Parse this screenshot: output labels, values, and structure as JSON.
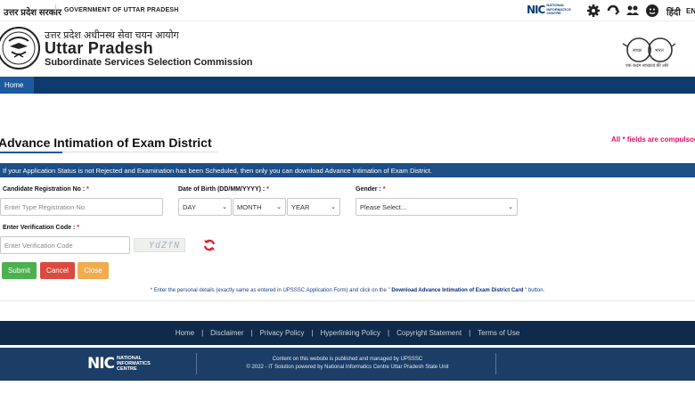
{
  "topbar": {
    "gov_hindi": "उत्तर प्रदेश सरकार",
    "gov_english": "GOVERNMENT OF UTTAR PRADESH",
    "nic_mark": "NIC",
    "nic_line1": "NATIONAL",
    "nic_line2": "INFORMATICS",
    "nic_line3": "CENTRE",
    "lang_hindi": "हिंदी",
    "lang_english": "EN"
  },
  "header": {
    "title_hindi": "उत्तर प्रदेश अधीनस्थ सेवा चयन आयोग",
    "title_main": "Uttar Pradesh",
    "title_sub": "Subordinate Services Selection Commission",
    "swachh_caption": "एक कदम स्वच्छता की ओर",
    "swachh_word1": "स्वच्छ",
    "swachh_word2": "भारत"
  },
  "nav": {
    "home_label": "Home"
  },
  "page": {
    "title": "Advance Intimation of Exam District",
    "required_note": "All * fields are compulsory",
    "info_bar": "If your Application Status is not Rejected and Examination has been Scheduled, then only you can download Advance Intimation of Exam District."
  },
  "form": {
    "reg_label": "Candidate Registration No : ",
    "reg_placeholder": "Enter Type Registration No.",
    "dob_label": "Date of Birth (DD/MM/YYYY) : ",
    "day_value": "DAY",
    "month_value": "MONTH",
    "year_value": "YEAR",
    "gender_label": "Gender : ",
    "gender_value": "Please Select...",
    "verif_label": "Enter Verification Code : ",
    "verif_placeholder": "Enter Verification Code",
    "captcha_text": "YdZfN",
    "required_mark": "*",
    "submit_label": "Submit",
    "cancel_label": "Cancel",
    "close_label": "Close",
    "instruction_pre": "* Enter the personal details (exactly same as entered in UPSSSC Application Form) and click on the \"",
    "instruction_link": " Download Advance Intimation of Exam District Card ",
    "instruction_post": "\" button."
  },
  "footer": {
    "links": [
      "Home",
      "Disclaimer",
      "Privacy Policy",
      "Hyperlinking Policy",
      "Copyright Statement",
      "Terms of Use"
    ],
    "separator": "|",
    "line1": "Content on this website is published and managed by UPSSSC",
    "line2": "© 2022 - IT Solution powered by National Informatics Centre Uttar Pradesh State Unit",
    "nic_mark": "NIC",
    "nic_line1": "NATIONAL",
    "nic_line2": "INFORMATICS",
    "nic_line3": "CENTRE"
  },
  "colors": {
    "nav_bg": "#0d3a6b",
    "info_bar_bg": "#1d4e86",
    "required_pink": "#e3106e",
    "submit_green": "#4caf50",
    "cancel_red": "#dc4a3f",
    "close_orange": "#f0ad4e",
    "footer_dark": "#0f2a4a"
  },
  "icons": [
    "settings-icon",
    "accessibility-icon",
    "screen-reader-icon",
    "contrast-icon",
    "refresh-captcha-icon"
  ]
}
